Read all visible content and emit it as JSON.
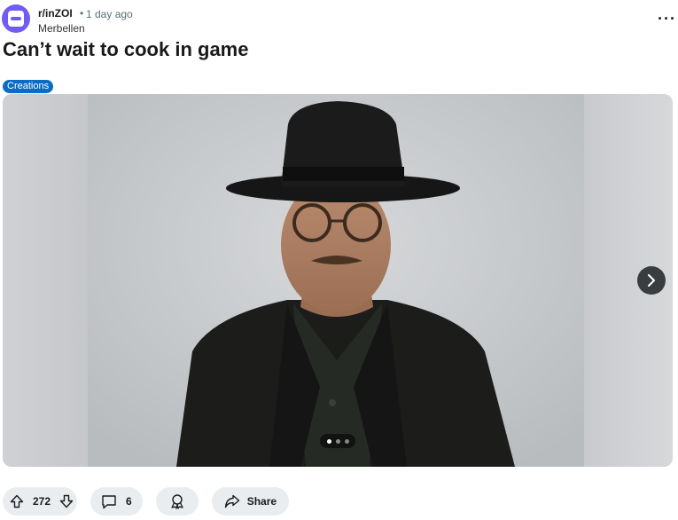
{
  "post": {
    "subreddit": "r/inZOI",
    "separator": "•",
    "time_ago": "1 day ago",
    "author": "Merbellen",
    "more_label": "···",
    "title": "Can’t wait to cook in game",
    "flair": "Creations",
    "flair_color": "#0a6cc4"
  },
  "gallery": {
    "image_description": "3D character wearing black fedora, round glasses and black jacket",
    "current_index": 1,
    "total": 3
  },
  "actions": {
    "upvotes": "272",
    "comments": "6",
    "share_label": "Share"
  },
  "icons": {
    "avatar": "subreddit-avatar-icon",
    "more": "more-options-icon",
    "next": "chevron-right-icon",
    "upvote": "upvote-arrow-icon",
    "downvote": "downvote-arrow-icon",
    "comment": "comment-bubble-icon",
    "award": "award-icon",
    "share": "share-arrow-icon"
  }
}
